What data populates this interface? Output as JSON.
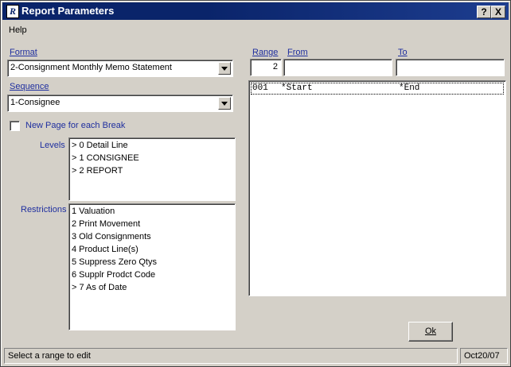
{
  "window": {
    "title": "Report Parameters",
    "app_icon": "report-app-icon",
    "help_button": "?",
    "close_button": "X"
  },
  "menu": {
    "help": "Help"
  },
  "format": {
    "label": "Format",
    "value": "2-Consignment Monthly Memo Statement"
  },
  "sequence": {
    "label": "Sequence",
    "value": "1-Consignee"
  },
  "new_page": {
    "label": "New Page for each Break",
    "checked": false
  },
  "levels": {
    "label": "Levels",
    "items": [
      "> 0 Detail Line",
      "> 1 CONSIGNEE",
      "> 2 REPORT"
    ]
  },
  "restrictions": {
    "label": "Restrictions",
    "items": [
      "1 Valuation",
      "2 Print Movement",
      "3 Old Consignments",
      "4 Product Line(s)",
      "5 Suppress Zero Qtys",
      "6 Supplr Prodct Code",
      "> 7 As of Date"
    ]
  },
  "range": {
    "range_label": "Range",
    "from_label": "From",
    "to_label": "To",
    "range_value": "2",
    "from_value": "",
    "to_value": "",
    "rows": [
      {
        "num": "001",
        "from": "*Start",
        "to": "*End"
      }
    ]
  },
  "ok_button": "Ok",
  "status": {
    "message": "Select a range to edit",
    "date": "Oct20/07"
  }
}
